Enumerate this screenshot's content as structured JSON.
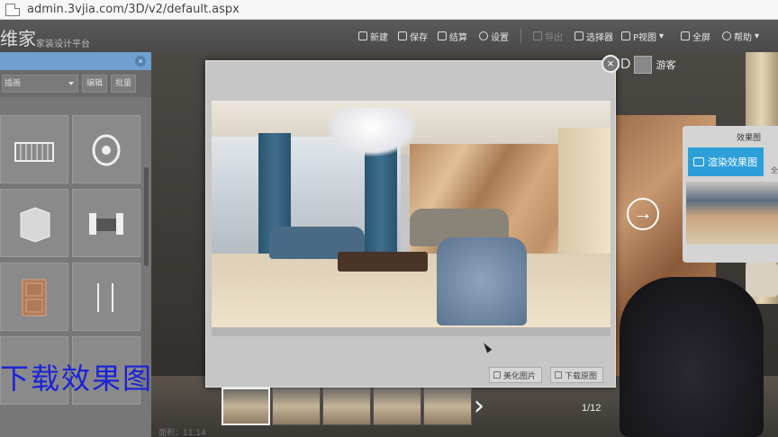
{
  "browser": {
    "url": "admin.3vjia.com/3D/v2/default.aspx"
  },
  "header": {
    "logo": "维家",
    "subtitle": "家装设计平台",
    "toolbar": {
      "new": "新建",
      "save": "保存",
      "settle": "结算",
      "settings": "设置",
      "dimmed": "导出",
      "selector": "选择器",
      "pview": "P视图",
      "fullscreen": "全屏",
      "help": "帮助"
    }
  },
  "left_panel": {
    "category": "插画",
    "edit_button": "编辑",
    "batch_button": "批量"
  },
  "login": {
    "mode": "3D",
    "label": "游客"
  },
  "render_panel": {
    "title": "效果图",
    "render_button": "渲染效果图",
    "side_label": "全"
  },
  "overlay_caption": "下载效果图",
  "modal": {
    "close": "×",
    "beautify_button": "美化图片",
    "download_button": "下载原图"
  },
  "gallery": {
    "counter": "1/12",
    "next": "›"
  },
  "footer": {
    "note": "面积：11.14"
  },
  "colors": {
    "accent": "#2d9fd8",
    "caption": "#1a22d8",
    "panel_header": "#6fa0d0"
  }
}
